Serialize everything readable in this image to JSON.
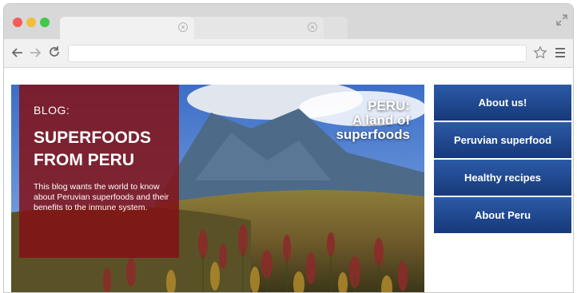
{
  "browser": {
    "tabs": [
      {
        "label": ""
      },
      {
        "label": ""
      }
    ],
    "address": ""
  },
  "hero": {
    "blog_kicker": "BLOG:",
    "blog_title": "SUPERFOODS FROM PERU",
    "blog_description": "This blog wants the world to know about Peruvian superfoods and their benefits to the inmune system.",
    "caption_line1": "PERU:",
    "caption_line2": "A land of",
    "caption_line3": "superfoods"
  },
  "nav": {
    "items": [
      {
        "label": "About us!"
      },
      {
        "label": "Peruvian superfood"
      },
      {
        "label": "Healthy recipes"
      },
      {
        "label": "About Peru"
      }
    ]
  },
  "colors": {
    "nav_button": "#1f478f",
    "blog_panel": "#821216",
    "close_dot": "#f35e57",
    "min_dot": "#f3bd3a",
    "max_dot": "#40c74c"
  },
  "icons": [
    "close-dot",
    "minimize-dot",
    "maximize-dot",
    "tab-close-icon",
    "expand-icon",
    "back-arrow-icon",
    "forward-arrow-icon",
    "reload-icon",
    "star-icon",
    "menu-icon"
  ]
}
